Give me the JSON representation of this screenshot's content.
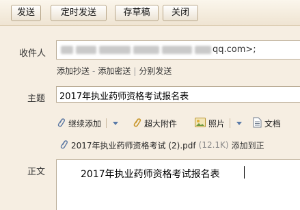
{
  "toolbar": {
    "send": "发送",
    "scheduled_send": "定时发送",
    "save_draft": "存草稿",
    "close": "关闭"
  },
  "recipient": {
    "label": "收件人",
    "visible_suffix": "qq.com>;"
  },
  "recipient_links": {
    "add_cc": "添加抄送",
    "add_bcc": "添加密送",
    "separate_send": "分别发送",
    "dash": "-",
    "pipe": "|"
  },
  "subject": {
    "label": "主题",
    "value": "2017年执业药师资格考试报名表"
  },
  "actions": {
    "continue_add": "继续添加",
    "large_attachment": "超大附件",
    "photo": "照片",
    "document": "文档"
  },
  "attachment": {
    "filename": "2017年执业药师资格考试 (2).pdf",
    "size": "(12.1K)",
    "add_to": "添加到正"
  },
  "body": {
    "label": "正文",
    "text": "2017年执业药师资格考试报名表"
  }
}
